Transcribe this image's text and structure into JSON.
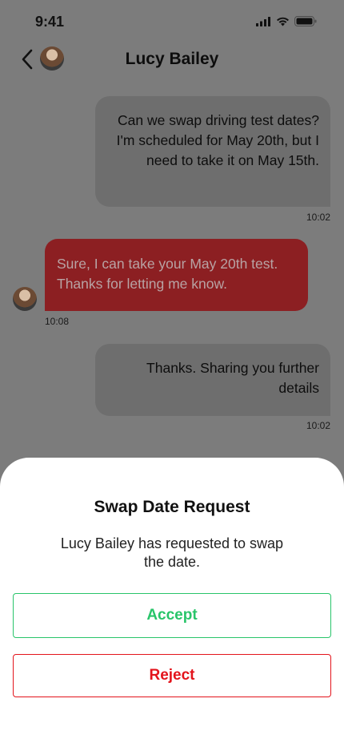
{
  "status_bar": {
    "time": "9:41"
  },
  "header": {
    "contact_name": "Lucy Bailey"
  },
  "messages": [
    {
      "direction": "incoming",
      "text": "Can we swap driving test dates? I'm scheduled for May 20th, but I need to take it on May 15th.",
      "time": "10:02"
    },
    {
      "direction": "outgoing",
      "text": "Sure, I can take your May 20th test. Thanks for letting me know.",
      "time": "10:08"
    },
    {
      "direction": "incoming",
      "text": "Thanks. Sharing you further details",
      "time": "10:02"
    }
  ],
  "sheet": {
    "title": "Swap Date Request",
    "message": "Lucy Bailey has requested to swap the date.",
    "accept_label": "Accept",
    "reject_label": "Reject"
  },
  "colors": {
    "accept": "#29c56a",
    "reject": "#e3141c",
    "outgoing_bubble": "#8c1f22",
    "incoming_bubble": "#6e6e6e",
    "overlay": "#7c7c7c"
  }
}
